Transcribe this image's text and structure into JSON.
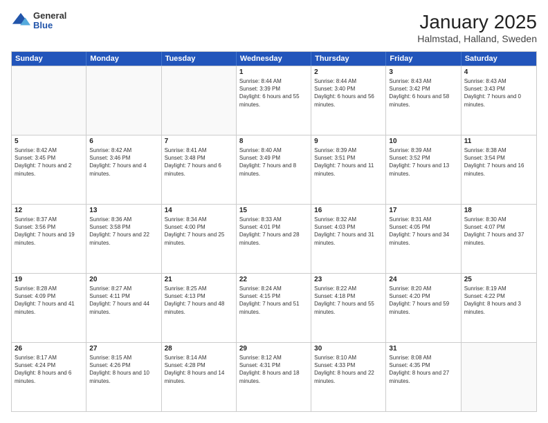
{
  "header": {
    "logo": {
      "general": "General",
      "blue": "Blue"
    },
    "title": "January 2025",
    "subtitle": "Halmstad, Halland, Sweden"
  },
  "calendar": {
    "days_of_week": [
      "Sunday",
      "Monday",
      "Tuesday",
      "Wednesday",
      "Thursday",
      "Friday",
      "Saturday"
    ],
    "weeks": [
      [
        {
          "day": "",
          "empty": true
        },
        {
          "day": "",
          "empty": true
        },
        {
          "day": "",
          "empty": true
        },
        {
          "day": "1",
          "sunrise": "8:44 AM",
          "sunset": "3:39 PM",
          "daylight": "6 hours and 55 minutes."
        },
        {
          "day": "2",
          "sunrise": "8:44 AM",
          "sunset": "3:40 PM",
          "daylight": "6 hours and 56 minutes."
        },
        {
          "day": "3",
          "sunrise": "8:43 AM",
          "sunset": "3:42 PM",
          "daylight": "6 hours and 58 minutes."
        },
        {
          "day": "4",
          "sunrise": "8:43 AM",
          "sunset": "3:43 PM",
          "daylight": "7 hours and 0 minutes."
        }
      ],
      [
        {
          "day": "5",
          "sunrise": "8:42 AM",
          "sunset": "3:45 PM",
          "daylight": "7 hours and 2 minutes."
        },
        {
          "day": "6",
          "sunrise": "8:42 AM",
          "sunset": "3:46 PM",
          "daylight": "7 hours and 4 minutes."
        },
        {
          "day": "7",
          "sunrise": "8:41 AM",
          "sunset": "3:48 PM",
          "daylight": "7 hours and 6 minutes."
        },
        {
          "day": "8",
          "sunrise": "8:40 AM",
          "sunset": "3:49 PM",
          "daylight": "7 hours and 8 minutes."
        },
        {
          "day": "9",
          "sunrise": "8:39 AM",
          "sunset": "3:51 PM",
          "daylight": "7 hours and 11 minutes."
        },
        {
          "day": "10",
          "sunrise": "8:39 AM",
          "sunset": "3:52 PM",
          "daylight": "7 hours and 13 minutes."
        },
        {
          "day": "11",
          "sunrise": "8:38 AM",
          "sunset": "3:54 PM",
          "daylight": "7 hours and 16 minutes."
        }
      ],
      [
        {
          "day": "12",
          "sunrise": "8:37 AM",
          "sunset": "3:56 PM",
          "daylight": "7 hours and 19 minutes."
        },
        {
          "day": "13",
          "sunrise": "8:36 AM",
          "sunset": "3:58 PM",
          "daylight": "7 hours and 22 minutes."
        },
        {
          "day": "14",
          "sunrise": "8:34 AM",
          "sunset": "4:00 PM",
          "daylight": "7 hours and 25 minutes."
        },
        {
          "day": "15",
          "sunrise": "8:33 AM",
          "sunset": "4:01 PM",
          "daylight": "7 hours and 28 minutes."
        },
        {
          "day": "16",
          "sunrise": "8:32 AM",
          "sunset": "4:03 PM",
          "daylight": "7 hours and 31 minutes."
        },
        {
          "day": "17",
          "sunrise": "8:31 AM",
          "sunset": "4:05 PM",
          "daylight": "7 hours and 34 minutes."
        },
        {
          "day": "18",
          "sunrise": "8:30 AM",
          "sunset": "4:07 PM",
          "daylight": "7 hours and 37 minutes."
        }
      ],
      [
        {
          "day": "19",
          "sunrise": "8:28 AM",
          "sunset": "4:09 PM",
          "daylight": "7 hours and 41 minutes."
        },
        {
          "day": "20",
          "sunrise": "8:27 AM",
          "sunset": "4:11 PM",
          "daylight": "7 hours and 44 minutes."
        },
        {
          "day": "21",
          "sunrise": "8:25 AM",
          "sunset": "4:13 PM",
          "daylight": "7 hours and 48 minutes."
        },
        {
          "day": "22",
          "sunrise": "8:24 AM",
          "sunset": "4:15 PM",
          "daylight": "7 hours and 51 minutes."
        },
        {
          "day": "23",
          "sunrise": "8:22 AM",
          "sunset": "4:18 PM",
          "daylight": "7 hours and 55 minutes."
        },
        {
          "day": "24",
          "sunrise": "8:20 AM",
          "sunset": "4:20 PM",
          "daylight": "7 hours and 59 minutes."
        },
        {
          "day": "25",
          "sunrise": "8:19 AM",
          "sunset": "4:22 PM",
          "daylight": "8 hours and 3 minutes."
        }
      ],
      [
        {
          "day": "26",
          "sunrise": "8:17 AM",
          "sunset": "4:24 PM",
          "daylight": "8 hours and 6 minutes."
        },
        {
          "day": "27",
          "sunrise": "8:15 AM",
          "sunset": "4:26 PM",
          "daylight": "8 hours and 10 minutes."
        },
        {
          "day": "28",
          "sunrise": "8:14 AM",
          "sunset": "4:28 PM",
          "daylight": "8 hours and 14 minutes."
        },
        {
          "day": "29",
          "sunrise": "8:12 AM",
          "sunset": "4:31 PM",
          "daylight": "8 hours and 18 minutes."
        },
        {
          "day": "30",
          "sunrise": "8:10 AM",
          "sunset": "4:33 PM",
          "daylight": "8 hours and 22 minutes."
        },
        {
          "day": "31",
          "sunrise": "8:08 AM",
          "sunset": "4:35 PM",
          "daylight": "8 hours and 27 minutes."
        },
        {
          "day": "",
          "empty": true
        }
      ]
    ],
    "labels": {
      "sunrise": "Sunrise:",
      "sunset": "Sunset:",
      "daylight": "Daylight:"
    }
  }
}
